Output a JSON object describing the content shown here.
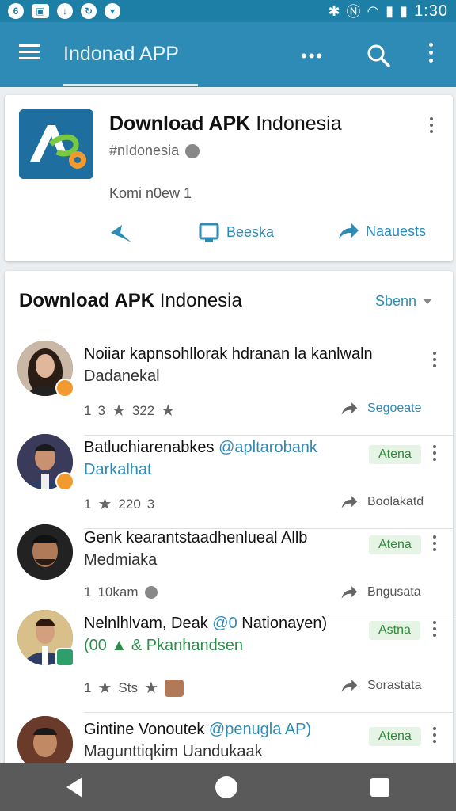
{
  "status_bar": {
    "time": "1:30"
  },
  "app_bar": {
    "title": "Indonad APP",
    "overflow": "•••"
  },
  "app_card": {
    "name_bold": "Download APK",
    "name_rest": " Indonesia",
    "subtitle": "#nIdonesia",
    "kom": "Komi n0ew 1",
    "actions": [
      {
        "label": "",
        "icon": "star-pin-icon"
      },
      {
        "label": "Beeska",
        "icon": "tablet-icon"
      },
      {
        "label": "Naauests",
        "icon": "share-arrow-icon"
      }
    ]
  },
  "list_section": {
    "title_bold": "Download APK",
    "title_rest": " Indonesia",
    "sort_label": "Sbenn",
    "items": [
      {
        "name": "Noiiar kapnsohllorak hdranan la kanlwaln",
        "name_accent": "",
        "sub": "Dadanekal",
        "meta": [
          "1",
          "3",
          "322"
        ],
        "action": "Segoeate",
        "chip": ""
      },
      {
        "name": "Batluchiarenabkes ",
        "name_accent": "@apltarobank",
        "sub": "Darkalhat",
        "meta": [
          "1",
          "220",
          "3"
        ],
        "action": "Boolakatd",
        "chip": "Atena"
      },
      {
        "name": "Genk kearantstaadhenlueal Allb",
        "name_accent": "",
        "sub": "Medmiaka",
        "meta": [
          "1",
          "10kam",
          ""
        ],
        "action": "Bngusata",
        "chip": "Atena"
      },
      {
        "name": "Nelnlhlvam, Deak ",
        "name_accent": "@0",
        "name_tail": " Nationayen)",
        "sub": "(00 ▲ & Pkanhandsen",
        "meta": [
          "1",
          "Sts",
          ""
        ],
        "action": "Sorastata",
        "chip": "Astna"
      },
      {
        "name": "Gintine Vonoutek ",
        "name_accent": "@penugla AP)",
        "sub": "Magunttiqkim Uandukaak",
        "meta": [
          "",
          "",
          ""
        ],
        "action": "",
        "chip": "Atena"
      }
    ]
  },
  "colors": {
    "primary": "#2e8bb5",
    "status_bar": "#1e7fa6",
    "chip_bg": "#e6f4e6",
    "chip_text": "#2e8b3a",
    "badge": "#f29a2e"
  }
}
